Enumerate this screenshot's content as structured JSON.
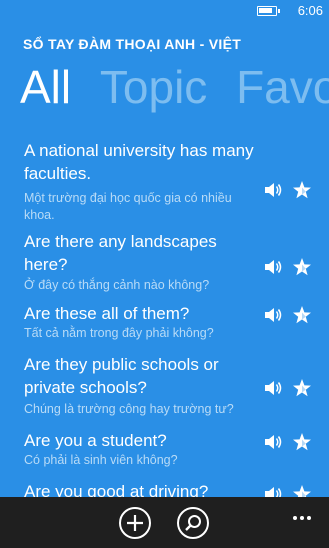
{
  "status_bar": {
    "time": "6:06",
    "battery_icon": "battery-icon"
  },
  "app": {
    "title": "SỔ TAY ĐÀM THOẠI ANH - VIỆT"
  },
  "pivot": {
    "tabs": [
      {
        "label": "All",
        "active": true
      },
      {
        "label": "Topic",
        "active": false
      },
      {
        "label": "Favou",
        "active": false
      }
    ]
  },
  "phrases": [
    {
      "en": "A national university has many faculties.",
      "vi": "Một trường đại học quốc gia có nhiều khoa."
    },
    {
      "en": "Are there any landscapes here?",
      "vi": "Ở đây có thắng cảnh nào không?"
    },
    {
      "en": "Are these all of them?",
      "vi": "Tất cả nằm trong đây phải không?"
    },
    {
      "en": "Are they public schools or private schools?",
      "vi": "Chúng là trường công hay trường tư?"
    },
    {
      "en": "Are you a student?",
      "vi": "Có phải là sinh viên không?"
    },
    {
      "en": "Are you good at driving?",
      "vi": ""
    }
  ],
  "icons": {
    "speaker": "speaker-icon",
    "star": "star-icon",
    "add": "add-icon",
    "search": "search-icon",
    "more": "more-icon"
  },
  "colors": {
    "accent": "#2a8fe6",
    "appbar": "#1f1f1f",
    "inactive_pivot": "#7dbdf0",
    "subtitle": "#b8dbf7"
  }
}
